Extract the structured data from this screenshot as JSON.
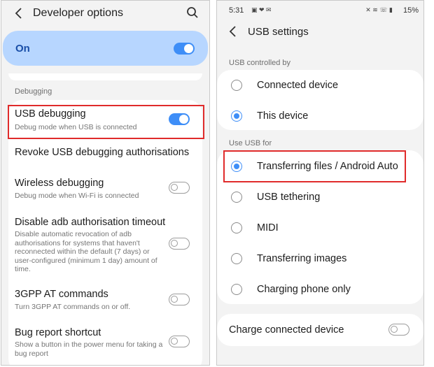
{
  "left": {
    "title": "Developer options",
    "master": {
      "label": "On",
      "on": true
    },
    "section": "Debugging",
    "items": [
      {
        "title": "USB debugging",
        "subtitle": "Debug mode when USB is connected",
        "toggle": "on"
      },
      {
        "title": "Revoke USB debugging authorisations",
        "subtitle": "",
        "toggle": null
      },
      {
        "title": "Wireless debugging",
        "subtitle": "Debug mode when Wi-Fi is connected",
        "toggle": "off"
      },
      {
        "title": "Disable adb authorisation timeout",
        "subtitle": "Disable automatic revocation of adb authorisations for systems that haven't reconnected within the default (7 days) or user-configured (minimum 1 day) amount of time.",
        "toggle": "off"
      },
      {
        "title": "3GPP AT commands",
        "subtitle": "Turn 3GPP AT commands on or off.",
        "toggle": "off"
      },
      {
        "title": "Bug report shortcut",
        "subtitle": "Show a button in the power menu for taking a bug report",
        "toggle": "off"
      }
    ]
  },
  "right": {
    "status": {
      "time": "5:31",
      "battery": "15%"
    },
    "title": "USB settings",
    "controlled_by": {
      "label": "USB controlled by",
      "options": [
        {
          "label": "Connected device",
          "selected": false
        },
        {
          "label": "This device",
          "selected": true
        }
      ]
    },
    "use_for": {
      "label": "Use USB for",
      "options": [
        {
          "label": "Transferring files / Android Auto",
          "selected": true
        },
        {
          "label": "USB tethering",
          "selected": false
        },
        {
          "label": "MIDI",
          "selected": false
        },
        {
          "label": "Transferring images",
          "selected": false
        },
        {
          "label": "Charging phone only",
          "selected": false
        }
      ]
    },
    "charge": {
      "label": "Charge connected device",
      "toggle": "off"
    }
  },
  "colors": {
    "accent": "#3e8ef7",
    "highlight_box": "#e02b2b",
    "on_bar": "#b7d6ff"
  }
}
